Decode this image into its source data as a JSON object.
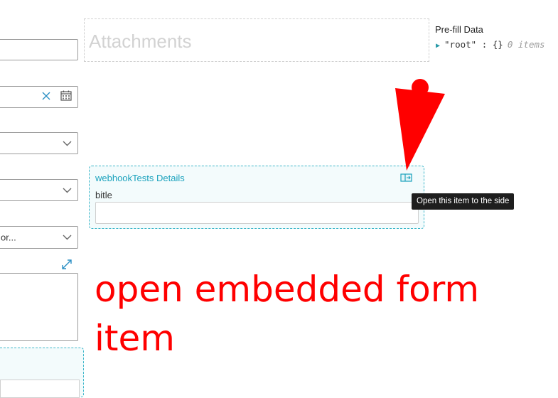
{
  "attachments": {
    "title": "Attachments"
  },
  "prefill": {
    "title": "Pre-fill Data",
    "key": "\"root\"",
    "separator": ":",
    "value": "{}",
    "count": "0 items"
  },
  "left_column": {
    "truncated_select_value": "or..."
  },
  "embedded_form": {
    "title": "webhookTests Details",
    "field_label": "bitle",
    "field_value": ""
  },
  "tooltip": {
    "text": "Open this item to the side"
  },
  "annotation": {
    "text": "open embedded form item"
  },
  "colors": {
    "annotation": "#ff0000",
    "accent": "#1aa2bd",
    "embedded_border": "#3bb6c9"
  },
  "icons": [
    "clear-icon",
    "calendar-icon",
    "chevron-down-icon",
    "expand-icon",
    "open-to-side-icon",
    "caret-right-icon",
    "arrow-pointer"
  ]
}
